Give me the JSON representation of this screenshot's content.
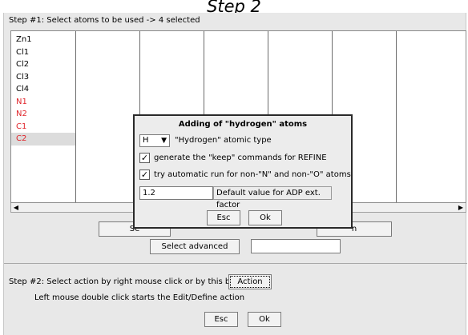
{
  "heading": "Step 2",
  "step1": {
    "label": "Step #1: Select atoms to be used  -> 4 selected"
  },
  "atoms": [
    {
      "name": "Zn1",
      "color": "#000000"
    },
    {
      "name": "Cl1",
      "color": "#000000"
    },
    {
      "name": "Cl2",
      "color": "#000000"
    },
    {
      "name": "Cl3",
      "color": "#000000"
    },
    {
      "name": "Cl4",
      "color": "#000000"
    },
    {
      "name": "N1",
      "color": "#e0252b"
    },
    {
      "name": "N2",
      "color": "#e0252b"
    },
    {
      "name": "C1",
      "color": "#e0252b"
    },
    {
      "name": "C2",
      "color": "#e0252b"
    }
  ],
  "select_buttons": {
    "left_partial": "Se",
    "right_partial": "n",
    "advanced": "Select advanced"
  },
  "step2": {
    "label": "Step #2: Select action by right mouse click or by this button:",
    "action_button": "Action",
    "hint": "Left mouse double click starts the Edit/Define action"
  },
  "bottom_buttons": {
    "esc": "Esc",
    "ok": "Ok"
  },
  "dialog": {
    "title": "Adding of \"hydrogen\" atoms",
    "combo_value": "H",
    "combo_label": "\"Hydrogen\" atomic type",
    "check1_label": "generate the \"keep\" commands for REFINE",
    "check1_checked": true,
    "check2_label": "try automatic run for non-\"N\" and non-\"O\" atoms",
    "check2_checked": true,
    "adp_value": "1.2",
    "adp_label": "Default value for ADP ext. factor",
    "esc": "Esc",
    "ok": "Ok"
  }
}
